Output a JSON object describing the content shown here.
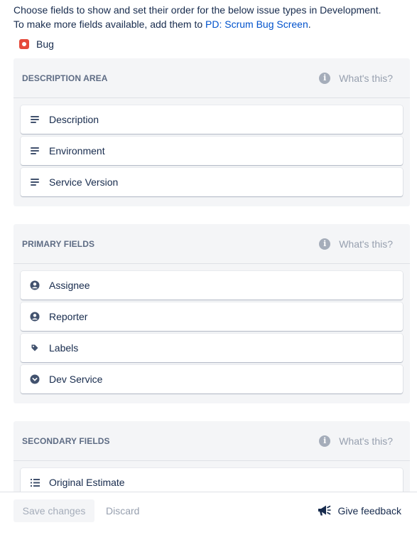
{
  "intro": {
    "line1": "Choose fields to show and set their order for the below issue types in Development.",
    "line2_prefix": "To make more fields available, add them to ",
    "link": "PD: Scrum Bug Screen",
    "line2_suffix": "."
  },
  "issue_type": {
    "label": "Bug",
    "icon": "bug-icon",
    "color": "#E5493A"
  },
  "sections": [
    {
      "title": "DESCRIPTION AREA",
      "help": "What's this?",
      "fields": [
        {
          "label": "Description",
          "icon": "paragraph-icon"
        },
        {
          "label": "Environment",
          "icon": "paragraph-icon"
        },
        {
          "label": "Service Version",
          "icon": "paragraph-icon"
        }
      ]
    },
    {
      "title": "PRIMARY FIELDS",
      "help": "What's this?",
      "fields": [
        {
          "label": "Assignee",
          "icon": "user-icon"
        },
        {
          "label": "Reporter",
          "icon": "user-icon"
        },
        {
          "label": "Labels",
          "icon": "tag-icon"
        },
        {
          "label": "Dev Service",
          "icon": "dropdown-icon"
        }
      ]
    },
    {
      "title": "SECONDARY FIELDS",
      "help": "What's this?",
      "fields": [
        {
          "label": "Original Estimate",
          "icon": "list-icon"
        }
      ]
    }
  ],
  "footer": {
    "save": "Save changes",
    "discard": "Discard",
    "feedback": "Give feedback"
  },
  "colors": {
    "link": "#0052CC",
    "section_bg": "#F4F5F7",
    "text": "#172B4D"
  }
}
